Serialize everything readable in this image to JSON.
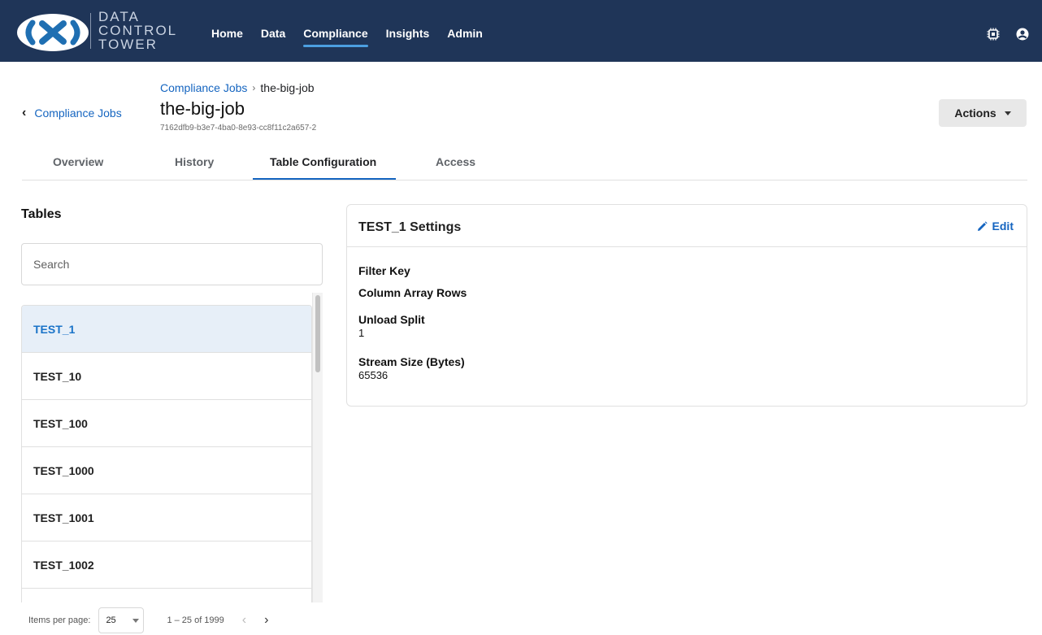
{
  "app": {
    "logo_text_lines": [
      "DATA",
      "CONTROL",
      "TOWER"
    ],
    "nav": [
      {
        "label": "Home",
        "active": false
      },
      {
        "label": "Data",
        "active": false
      },
      {
        "label": "Compliance",
        "active": true
      },
      {
        "label": "Insights",
        "active": false
      },
      {
        "label": "Admin",
        "active": false
      }
    ],
    "top_icons": [
      "chip-icon",
      "account-icon"
    ],
    "colors": {
      "nav_bg": "#1f3558",
      "accent": "#1565c0",
      "selected_row": "#e7eff8"
    }
  },
  "header": {
    "back_label": "Compliance Jobs",
    "breadcrumb": {
      "parent": "Compliance Jobs",
      "separator": "›",
      "current": "the-big-job"
    },
    "title": "the-big-job",
    "job_id": "7162dfb9-b3e7-4ba0-8e93-cc8f11c2a657-2",
    "actions_label": "Actions"
  },
  "tabs": [
    {
      "label": "Overview",
      "active": false
    },
    {
      "label": "History",
      "active": false
    },
    {
      "label": "Table Configuration",
      "active": true
    },
    {
      "label": "Access",
      "active": false
    }
  ],
  "tables_panel": {
    "title": "Tables",
    "search_placeholder": "Search",
    "items": [
      {
        "label": "TEST_1",
        "selected": true
      },
      {
        "label": "TEST_10",
        "selected": false
      },
      {
        "label": "TEST_100",
        "selected": false
      },
      {
        "label": "TEST_1000",
        "selected": false
      },
      {
        "label": "TEST_1001",
        "selected": false
      },
      {
        "label": "TEST_1002",
        "selected": false
      }
    ],
    "paginator": {
      "items_per_page_label": "Items per page:",
      "page_size": "25",
      "range": "1 – 25 of 1999",
      "prev": "‹",
      "next": "›"
    }
  },
  "settings": {
    "title": "TEST_1 Settings",
    "edit_label": "Edit",
    "fields": [
      {
        "label": "Filter Key",
        "value": ""
      },
      {
        "label": "Column Array Rows",
        "value": ""
      },
      {
        "label": "Unload Split",
        "value": "1"
      },
      {
        "label": "Stream Size (Bytes)",
        "value": "65536"
      }
    ]
  }
}
